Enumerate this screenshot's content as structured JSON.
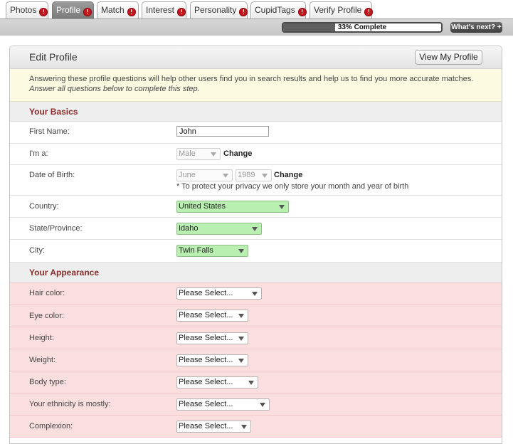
{
  "tabs": [
    {
      "label": "Photos",
      "active": false
    },
    {
      "label": "Profile",
      "active": true
    },
    {
      "label": "Match",
      "active": false
    },
    {
      "label": "Interest",
      "active": false
    },
    {
      "label": "Personality",
      "active": false
    },
    {
      "label": "CupidTags",
      "active": false
    },
    {
      "label": "Verify Profile",
      "active": false
    }
  ],
  "tab_badge": "!",
  "progress": {
    "percent": 33,
    "text": "33% Complete"
  },
  "whats_next_label": "What's next? +",
  "panel": {
    "title": "Edit Profile",
    "view_button": "View My Profile",
    "info_line1": "Answering these profile questions will help other users find you in search results and help us to find you more accurate matches.",
    "info_line2": "Answer all questions below to complete this step."
  },
  "basics": {
    "heading": "Your Basics",
    "first_name_label": "First Name:",
    "first_name_value": "John",
    "gender_label": "I'm a:",
    "gender_value": "Male",
    "change_label": "Change",
    "dob_label": "Date of Birth:",
    "dob_month": "June",
    "dob_year": "1989",
    "dob_note": "* To protect your privacy we only store your month and year of birth",
    "country_label": "Country:",
    "country_value": "United States",
    "state_label": "State/Province:",
    "state_value": "Idaho",
    "city_label": "City:",
    "city_value": "Twin Falls"
  },
  "appearance": {
    "heading": "Your Appearance",
    "placeholder": "Please Select...",
    "fields": [
      {
        "label": "Hair color:"
      },
      {
        "label": "Eye color:"
      },
      {
        "label": "Height:"
      },
      {
        "label": "Weight:"
      },
      {
        "label": "Body type:"
      },
      {
        "label": "Your ethnicity is mostly:"
      },
      {
        "label": "Complexion:"
      }
    ]
  },
  "colors": {
    "section_heading": "#8b2c2c",
    "badge_red": "#c4161c",
    "valid_green": "#b9f0b1",
    "required_pink": "#fbdfdf",
    "info_yellow": "#fcfbe2"
  }
}
